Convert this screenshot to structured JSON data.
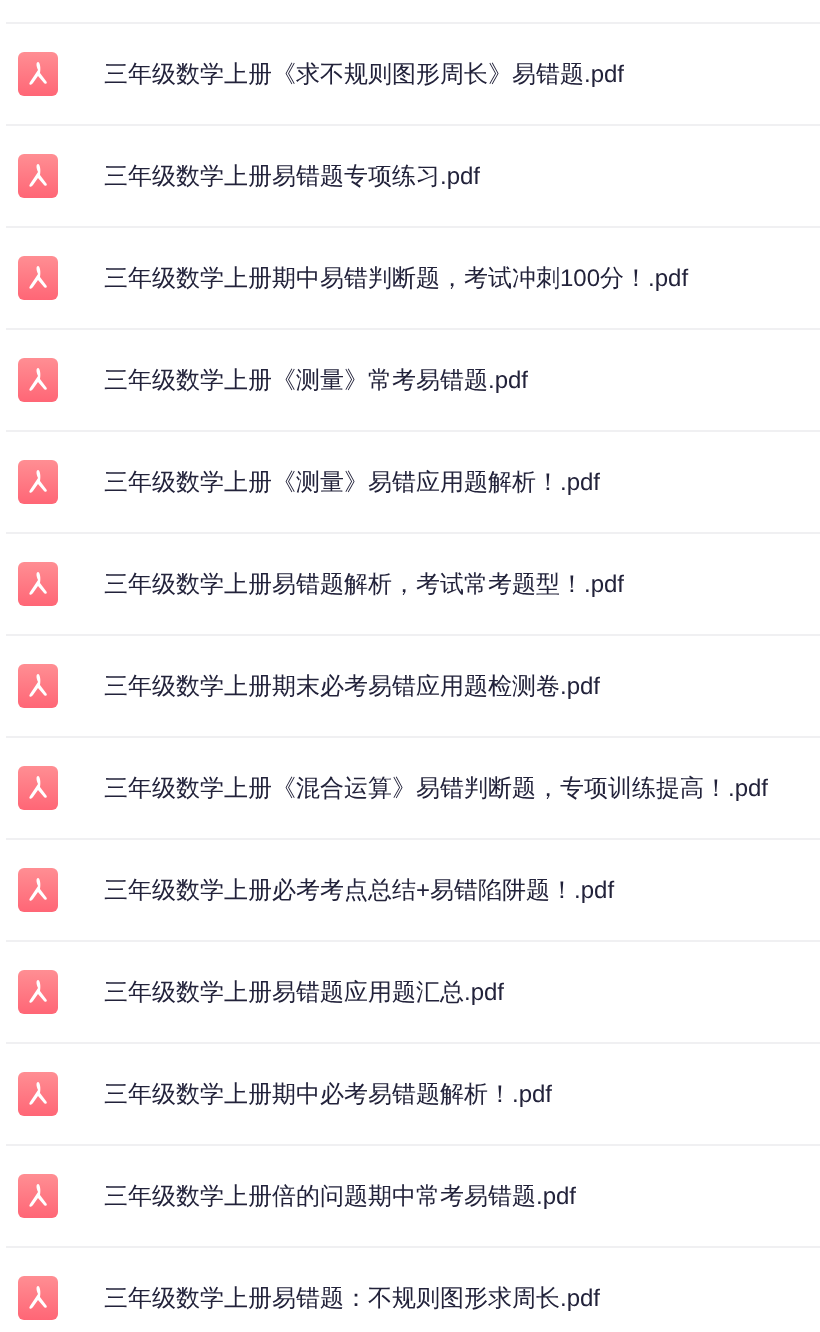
{
  "files": [
    {
      "kind": "pdf",
      "name": "三年级数学上册《求不规则图形周长》易错题.pdf"
    },
    {
      "kind": "pdf",
      "name": "三年级数学上册易错题专项练习.pdf"
    },
    {
      "kind": "pdf",
      "name": "三年级数学上册期中易错判断题，考试冲刺100分！.pdf"
    },
    {
      "kind": "pdf",
      "name": "三年级数学上册《测量》常考易错题.pdf"
    },
    {
      "kind": "pdf",
      "name": "三年级数学上册《测量》易错应用题解析！.pdf"
    },
    {
      "kind": "pdf",
      "name": "三年级数学上册易错题解析，考试常考题型！.pdf"
    },
    {
      "kind": "pdf",
      "name": "三年级数学上册期末必考易错应用题检测卷.pdf"
    },
    {
      "kind": "pdf",
      "name": "三年级数学上册《混合运算》易错判断题，专项训练提高！.pdf"
    },
    {
      "kind": "pdf",
      "name": "三年级数学上册必考考点总结+易错陷阱题！.pdf"
    },
    {
      "kind": "pdf",
      "name": "三年级数学上册易错题应用题汇总.pdf"
    },
    {
      "kind": "pdf",
      "name": "三年级数学上册期中必考易错题解析！.pdf"
    },
    {
      "kind": "pdf",
      "name": "三年级数学上册倍的问题期中常考易错题.pdf"
    },
    {
      "kind": "pdf",
      "name": "三年级数学上册易错题：不规则图形求周长.pdf"
    }
  ]
}
